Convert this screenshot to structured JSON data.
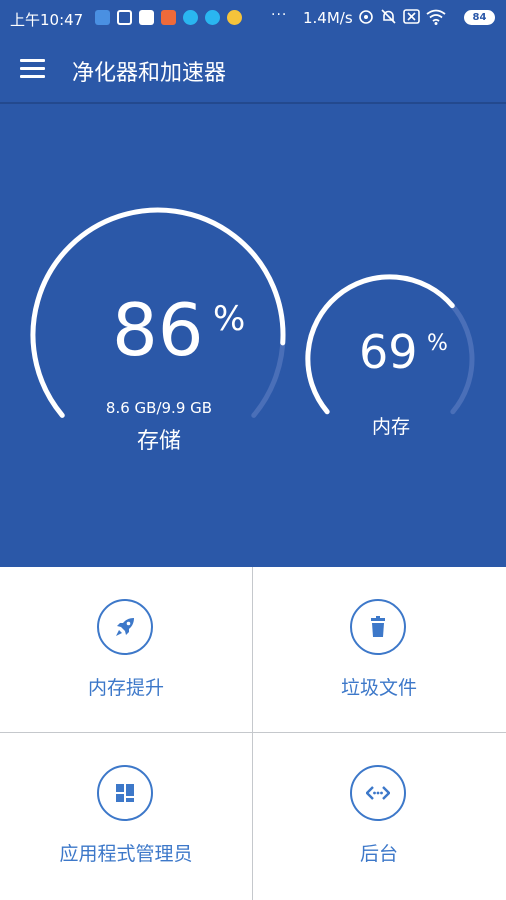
{
  "status_bar": {
    "time": "上午10:47",
    "dots": "···",
    "network_speed": "1.4M/s",
    "battery": "84"
  },
  "app_bar": {
    "title": "净化器和加速器"
  },
  "storage_gauge": {
    "percent": "86",
    "percent_value": 86,
    "percent_sign": "%",
    "detail": "8.6 GB/9.9 GB",
    "label": "存储"
  },
  "memory_gauge": {
    "percent": "69",
    "percent_value": 69,
    "percent_sign": "%",
    "label": "内存"
  },
  "tiles": [
    {
      "label": "内存提升",
      "icon": "rocket-icon"
    },
    {
      "label": "垃圾文件",
      "icon": "trash-icon"
    },
    {
      "label": "应用程式管理员",
      "icon": "apps-grid-icon"
    },
    {
      "label": "后台",
      "icon": "code-brackets-icon"
    }
  ],
  "colors": {
    "primary": "#2b58a8",
    "accent": "#3d78c9",
    "track": "#4a6fb8"
  }
}
